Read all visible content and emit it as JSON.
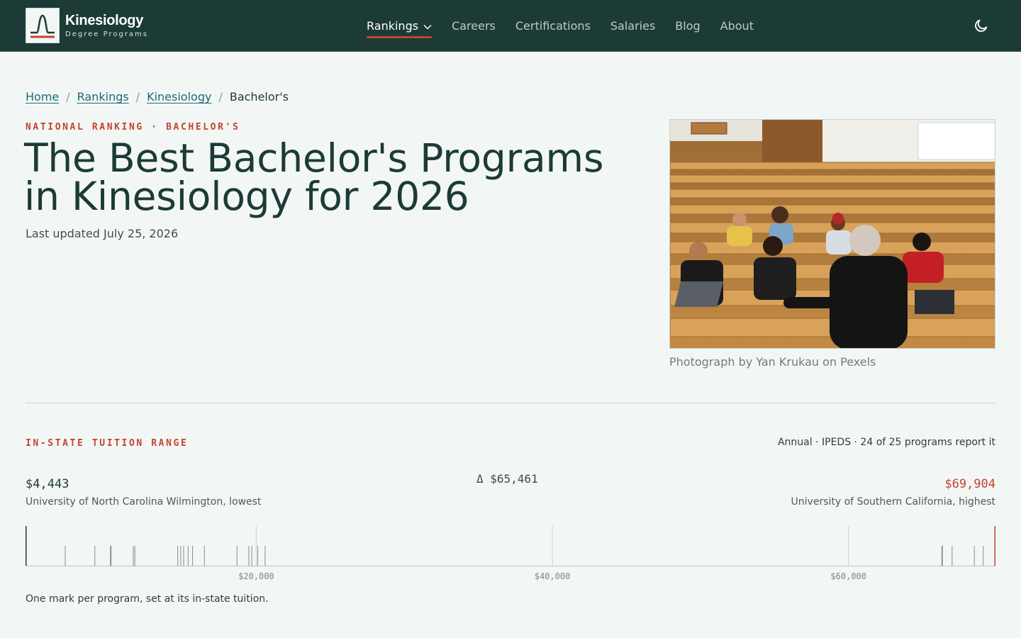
{
  "header": {
    "logo_title": "Kinesiology",
    "logo_subtitle": "Degree Programs",
    "nav": [
      {
        "label": "Rankings",
        "active": true,
        "has_dropdown": true
      },
      {
        "label": "Careers"
      },
      {
        "label": "Certifications"
      },
      {
        "label": "Salaries"
      },
      {
        "label": "Blog"
      },
      {
        "label": "About"
      }
    ],
    "theme_toggle_icon": "moon-icon"
  },
  "breadcrumb": {
    "items": [
      "Home",
      "Rankings",
      "Kinesiology"
    ],
    "current": "Bachelor's"
  },
  "hero": {
    "eyebrow": "NATIONAL RANKING · BACHELOR'S",
    "title": "The Best Bachelor's Programs in Kinesiology for 2026",
    "updated": "Last updated July 25, 2026",
    "photo_caption": "Photograph by Yan Krukau on Pexels"
  },
  "tuition": {
    "section_title": "IN-STATE TUITION RANGE",
    "meta": "Annual · IPEDS · 24 of 25 programs report it",
    "low_value": "$4,443",
    "low_label": "University of North Carolina Wilmington, lowest",
    "delta": "Δ $65,461",
    "high_value": "$69,904",
    "high_label": "University of Southern California, highest",
    "footnote": "One mark per program, set at its in-state tuition."
  },
  "chart_data": {
    "type": "strip",
    "xlim": [
      4443,
      69904
    ],
    "ticks": [
      20000,
      40000,
      60000
    ],
    "tick_labels": [
      "$20,000",
      "$40,000",
      "$60,000"
    ],
    "values": [
      4443,
      7100,
      9100,
      10200,
      11700,
      11800,
      14700,
      14900,
      15100,
      15400,
      15700,
      16500,
      18700,
      19500,
      20100,
      20600,
      66300,
      67000,
      69100,
      68500,
      69904,
      66350,
      19700,
      10150
    ],
    "colors": {
      "mark": "#7f8f8b",
      "low": "#1d3a35",
      "high": "#c5432f",
      "axis": "#b8c4c0"
    }
  }
}
